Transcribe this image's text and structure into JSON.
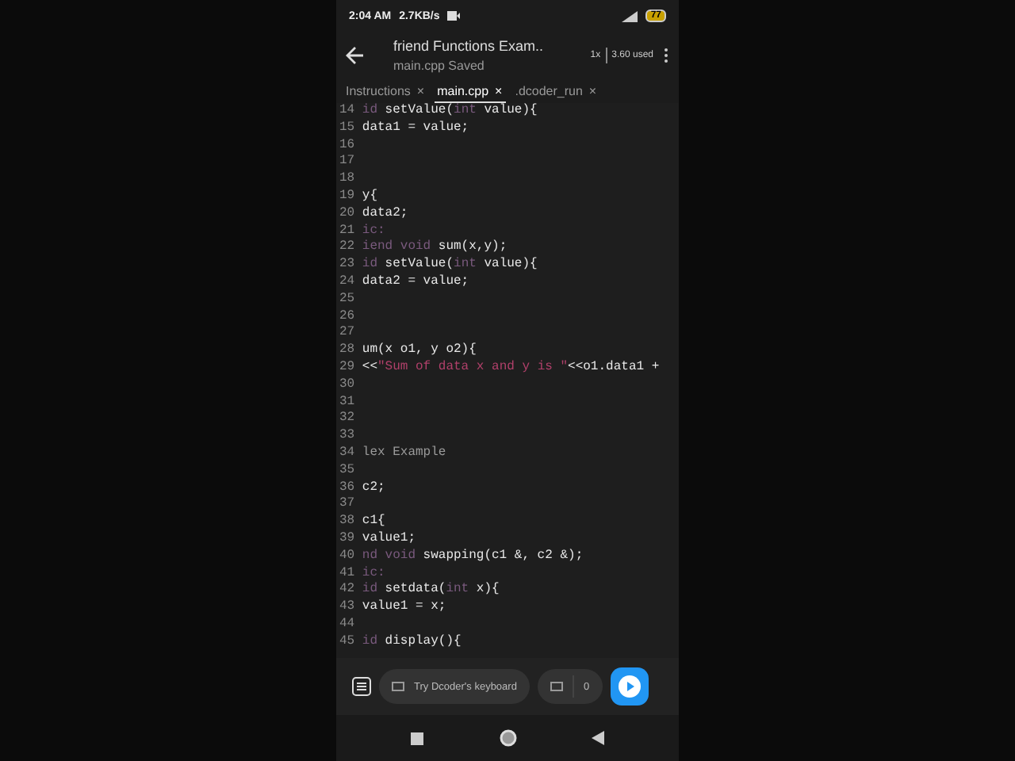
{
  "status_bar": {
    "time": "2:04 AM",
    "speed": "2.7KB/s",
    "battery": "77"
  },
  "header": {
    "title": "friend Functions Exam..",
    "subtitle": "main.cpp Saved",
    "speed_badge": "1x",
    "usage": "3.60 used"
  },
  "tabs": [
    {
      "label": "Instructions",
      "close": "×",
      "selected": false
    },
    {
      "label": "main.cpp",
      "close": "×",
      "selected": true
    },
    {
      "label": ".dcoder_run",
      "close": "×",
      "selected": false
    }
  ],
  "code_lines": [
    {
      "number": "14",
      "tokens": [
        {
          "kind": "keyword",
          "text": "id "
        },
        {
          "kind": "plain",
          "text": "setValue("
        },
        {
          "kind": "keyword",
          "text": "int"
        },
        {
          "kind": "plain",
          "text": " value){"
        }
      ]
    },
    {
      "number": "15",
      "tokens": [
        {
          "kind": "plain",
          "text": "data1 = value;"
        }
      ]
    },
    {
      "number": "16"
    },
    {
      "number": "17"
    },
    {
      "number": "18"
    },
    {
      "number": "19",
      "tokens": [
        {
          "kind": "plain",
          "text": "y{"
        }
      ]
    },
    {
      "number": "20",
      "tokens": [
        {
          "kind": "plain",
          "text": "data2;"
        }
      ]
    },
    {
      "number": "21",
      "tokens": [
        {
          "kind": "keyword",
          "text": "ic:"
        }
      ]
    },
    {
      "number": "22",
      "tokens": [
        {
          "kind": "keyword",
          "text": "iend void "
        },
        {
          "kind": "plain",
          "text": "sum(x,y);"
        }
      ]
    },
    {
      "number": "23",
      "tokens": [
        {
          "kind": "keyword",
          "text": "id "
        },
        {
          "kind": "plain",
          "text": "setValue("
        },
        {
          "kind": "keyword",
          "text": "int"
        },
        {
          "kind": "plain",
          "text": " value){"
        }
      ]
    },
    {
      "number": "24",
      "tokens": [
        {
          "kind": "plain",
          "text": "data2 = value;"
        }
      ]
    },
    {
      "number": "25"
    },
    {
      "number": "26"
    },
    {
      "number": "27"
    },
    {
      "number": "28",
      "tokens": [
        {
          "kind": "plain",
          "text": "um(x o1, y o2){"
        }
      ]
    },
    {
      "number": "29",
      "tokens": [
        {
          "kind": "plain",
          "text": "<<"
        },
        {
          "kind": "string",
          "text": "\"Sum of data x and y is \""
        },
        {
          "kind": "plain",
          "text": "<<o1.data1 +"
        }
      ]
    },
    {
      "number": "30"
    },
    {
      "number": "31"
    },
    {
      "number": "32"
    },
    {
      "number": "33"
    },
    {
      "number": "34",
      "tokens": [
        {
          "kind": "comment",
          "text": "lex Example"
        }
      ]
    },
    {
      "number": "35"
    },
    {
      "number": "36",
      "tokens": [
        {
          "kind": "plain",
          "text": "c2;"
        }
      ]
    },
    {
      "number": "37"
    },
    {
      "number": "38",
      "tokens": [
        {
          "kind": "plain",
          "text": "c1{"
        }
      ]
    },
    {
      "number": "39",
      "tokens": [
        {
          "kind": "plain",
          "text": "value1;"
        }
      ]
    },
    {
      "number": "40",
      "tokens": [
        {
          "kind": "keyword",
          "text": "nd void "
        },
        {
          "kind": "plain",
          "text": "swapping(c1 &, c2 &);"
        }
      ]
    },
    {
      "number": "41",
      "tokens": [
        {
          "kind": "keyword",
          "text": "ic:"
        }
      ]
    },
    {
      "number": "42",
      "tokens": [
        {
          "kind": "keyword",
          "text": "id "
        },
        {
          "kind": "plain",
          "text": "setdata("
        },
        {
          "kind": "keyword",
          "text": "int"
        },
        {
          "kind": "plain",
          "text": " x){"
        }
      ]
    },
    {
      "number": "43",
      "tokens": [
        {
          "kind": "plain",
          "text": "value1 = x;"
        }
      ]
    },
    {
      "number": "44"
    },
    {
      "number": "45",
      "tokens": [
        {
          "kind": "keyword",
          "text": "id "
        },
        {
          "kind": "plain",
          "text": "display(){"
        }
      ]
    }
  ],
  "bottom_bar": {
    "keyboard_hint": "Try Dcoder's keyboard",
    "count": "0"
  }
}
